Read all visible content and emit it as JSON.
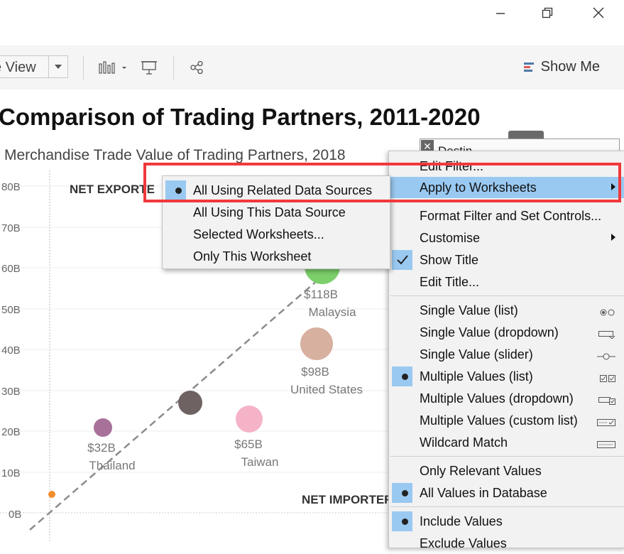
{
  "window": {
    "minimize_icon": "minimize-icon",
    "restore_icon": "restore-icon",
    "close_icon": "close-icon"
  },
  "toolbar": {
    "view_label": "e View",
    "show_me_label": "Show Me"
  },
  "sheet": {
    "title": "Comparison of Trading Partners, 2011-2020",
    "subtitle": "Merchandise Trade Value of Trading Partners, 2018",
    "filter_name": "Destin",
    "quadrants": {
      "exporter": "NET EXPORTE",
      "importer": "NET IMPORTER"
    },
    "y_ticks": [
      "80B",
      "70B",
      "60B",
      "50B",
      "40B",
      "30B",
      "20B",
      "10B",
      "0B"
    ],
    "bubbles": [
      {
        "value_label": "$118B",
        "name_label": "Malaysia",
        "color": "#7ccf6a"
      },
      {
        "value_label": "$98B",
        "name_label": "United States",
        "color": "#d8b0a0"
      },
      {
        "value_label": "$65B",
        "name_label": "Taiwan",
        "color": "#f5b3c8"
      },
      {
        "value_label": "$32B",
        "name_label": "Thailand",
        "color": "#a8719a"
      },
      {
        "value_label": "",
        "name_label": "",
        "color": "#6e6362"
      },
      {
        "value_label": "",
        "name_label": "",
        "color": "#f28e2b"
      }
    ]
  },
  "context_menu": {
    "items": [
      {
        "label": "Edit Filter..."
      },
      {
        "label": "Apply to Worksheets"
      },
      {
        "label": "Format Filter and Set Controls..."
      },
      {
        "label": "Customise"
      },
      {
        "label": "Show Title"
      },
      {
        "label": "Edit Title..."
      },
      {
        "label": "Single Value (list)"
      },
      {
        "label": "Single Value (dropdown)"
      },
      {
        "label": "Single Value (slider)"
      },
      {
        "label": "Multiple Values (list)"
      },
      {
        "label": "Multiple Values (dropdown)"
      },
      {
        "label": "Multiple Values (custom list)"
      },
      {
        "label": "Wildcard Match"
      },
      {
        "label": "Only Relevant Values"
      },
      {
        "label": "All Values in Database"
      },
      {
        "label": "Include Values"
      },
      {
        "label": "Exclude Values"
      }
    ]
  },
  "submenu": {
    "items": [
      {
        "label": "All Using Related Data Sources",
        "selected": true
      },
      {
        "label": "All Using This Data Source",
        "selected": false
      },
      {
        "label": "Selected Worksheets...",
        "selected": false
      },
      {
        "label": "Only This Worksheet",
        "selected": false
      }
    ]
  },
  "colors": {
    "highlight": "#f0393b",
    "menu_active": "#99c9f1"
  }
}
